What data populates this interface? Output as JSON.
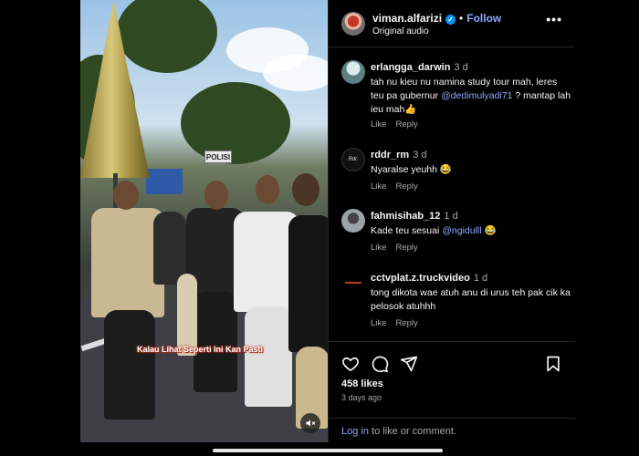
{
  "post": {
    "username": "viman.alfarizi",
    "follow_label": "Follow",
    "audio": "Original audio",
    "more": "•••"
  },
  "media": {
    "sign_text": "POLISI",
    "caption": "Kalau Lihat Seperti Ini Kan Pasti"
  },
  "comments": [
    {
      "user": "erlangga_darwin",
      "time": "3 d",
      "text_before": "tah nu kieu nu namina study tour mah, leres teu pa gubernur ",
      "mention": "@dedimulyadi71",
      "text_after": " ? mantap lah ieu mah👍",
      "like": "Like",
      "reply": "Reply"
    },
    {
      "user": "rddr_rm",
      "time": "3 d",
      "text_before": "Nyaralse yeuhh 😂",
      "mention": "",
      "text_after": "",
      "like": "Like",
      "reply": "Reply"
    },
    {
      "user": "fahmisihab_12",
      "time": "1 d",
      "text_before": "Kade teu sesuai ",
      "mention": "@ngidulll",
      "text_after": " 😂",
      "like": "Like",
      "reply": "Reply"
    },
    {
      "user": "cctvplat.z.truckvideo",
      "time": "1 d",
      "text_before": "tong dikota wae atuh anu di urus teh pak cik ka pelosok atuhhh",
      "mention": "",
      "text_after": "",
      "like": "Like",
      "reply": "Reply"
    }
  ],
  "stats": {
    "likes": "458 likes",
    "posted": "3 days ago"
  },
  "login": {
    "link": "Log in",
    "text": " to like or comment."
  },
  "colors": {
    "accent": "#8ea8ff",
    "verified": "#0095f6",
    "muted": "#a8a8a8"
  },
  "icons": [
    "heart-icon",
    "comment-icon",
    "share-icon",
    "bookmark-icon",
    "mute-icon",
    "verified-icon"
  ]
}
